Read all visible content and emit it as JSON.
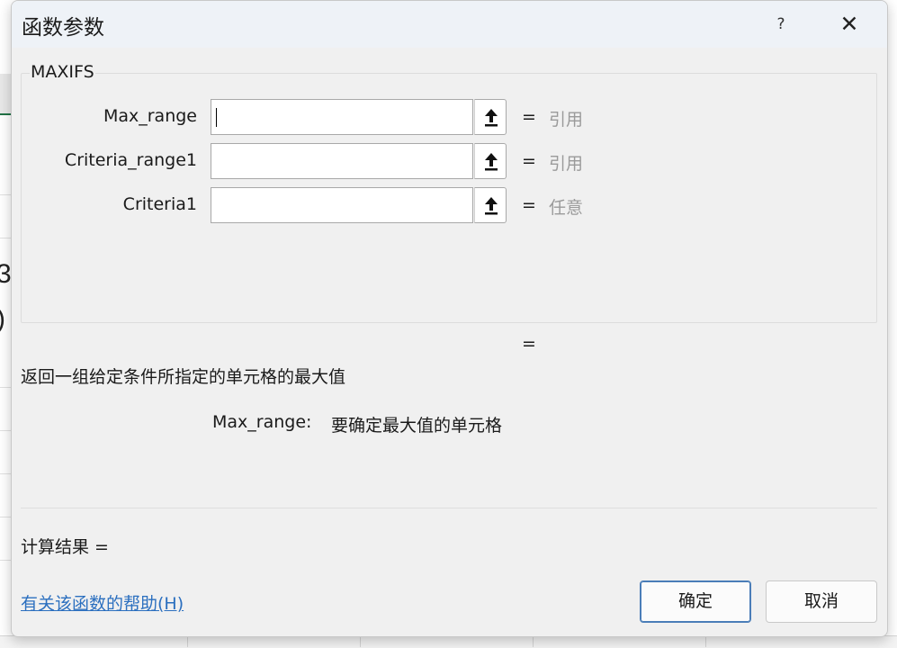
{
  "dialog": {
    "title": "函数参数",
    "help_glyph": "?",
    "close_glyph": "✕"
  },
  "function_name": "MAXIFS",
  "arguments": [
    {
      "label": "Max_range",
      "value": "",
      "equals": "=",
      "type_hint": "引用"
    },
    {
      "label": "Criteria_range1",
      "value": "",
      "equals": "=",
      "type_hint": "引用"
    },
    {
      "label": "Criteria1",
      "value": "",
      "equals": "=",
      "type_hint": "任意"
    }
  ],
  "result_equals": "=",
  "description": "返回一组给定条件所指定的单元格的最大值",
  "arg_description": {
    "name": "Max_range:",
    "text": "要确定最大值的单元格"
  },
  "calc_result_label": "计算结果 =",
  "help_link": "有关该函数的帮助(H)",
  "buttons": {
    "ok": "确定",
    "cancel": "取消"
  },
  "background": {
    "cell_fragment_1": "3",
    "cell_fragment_2": ")"
  },
  "colors": {
    "link": "#2b6fbf",
    "hint": "#9a9a9a",
    "primary_border": "#4a7db8",
    "excel_green": "#217346"
  },
  "icons": [
    "upload-arrow-icon",
    "help-icon",
    "close-icon"
  ]
}
